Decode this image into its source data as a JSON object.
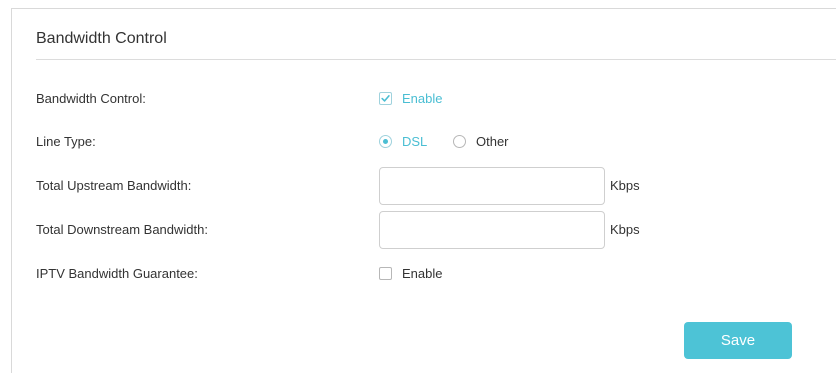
{
  "section": {
    "title": "Bandwidth Control"
  },
  "form": {
    "bandwidth_control": {
      "label": "Bandwidth Control:",
      "option_label": "Enable",
      "checked": true
    },
    "line_type": {
      "label": "Line Type:",
      "options": [
        {
          "label": "DSL",
          "selected": true
        },
        {
          "label": "Other",
          "selected": false
        }
      ]
    },
    "upstream": {
      "label": "Total Upstream Bandwidth:",
      "value": "",
      "unit": "Kbps"
    },
    "downstream": {
      "label": "Total Downstream Bandwidth:",
      "value": "",
      "unit": "Kbps"
    },
    "iptv": {
      "label": "IPTV Bandwidth Guarantee:",
      "option_label": "Enable",
      "checked": false
    }
  },
  "actions": {
    "save_label": "Save"
  },
  "colors": {
    "accent": "#4abed3",
    "button": "#4dc3d6",
    "border": "#d9d9d9",
    "text": "#333333"
  },
  "icons": {
    "checkmark": "checkmark-icon"
  }
}
